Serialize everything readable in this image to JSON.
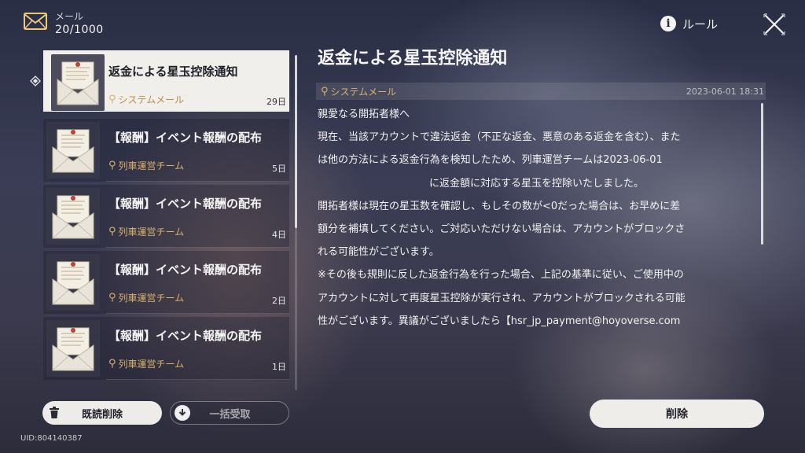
{
  "header": {
    "mail_label": "メール",
    "mail_count": "20/1000",
    "rule_label": "ルール",
    "rule_icon": "info-icon",
    "close_icon": "close-x-icon"
  },
  "mail_list": [
    {
      "subject": "返金による星玉控除通知",
      "sender": "システムメール",
      "age": "29日",
      "selected": true
    },
    {
      "subject": "【報酬】イベント報酬の配布",
      "sender": "列車運営チーム",
      "age": "5日",
      "selected": false
    },
    {
      "subject": "【報酬】イベント報酬の配布",
      "sender": "列車運営チーム",
      "age": "4日",
      "selected": false
    },
    {
      "subject": "【報酬】イベント報酬の配布",
      "sender": "列車運営チーム",
      "age": "2日",
      "selected": false
    },
    {
      "subject": "【報酬】イベント報酬の配布",
      "sender": "列車運営チーム",
      "age": "1日",
      "selected": false
    }
  ],
  "buttons": {
    "delete_read": "既読削除",
    "receive_all": "一括受取",
    "delete": "削除"
  },
  "uid": "UID:804140387",
  "detail": {
    "title": "返金による星玉控除通知",
    "sender": "システムメール",
    "date": "2023-06-01 18:31",
    "lines": [
      "親愛なる開拓者様へ",
      "現在、当該アカウントで違法返金（不正な返金、悪意のある返金を含む）、また",
      "は他の方法による返金行為を検知したため、列車運営チームは2023-06-01",
      "に返金額に対応する星玉を控除いたしました。",
      "開拓者様は現在の星玉数を確認し、もしその数が<0だった場合は、お早めに差",
      "額分を補填してください。ご対応いただけない場合は、アカウントがブロックさ",
      "れる可能性がございます。",
      "※その後も規則に反した返金行為を行った場合、上記の基準に従い、ご使用中の",
      "アカウントに対して再度星玉控除が実行され、アカウントがブロックされる可能",
      "性がございます。異議がございましたら【hsr_jp_payment@hoyoverse.com"
    ]
  },
  "colors": {
    "accent_gold": "#d8b26a",
    "selected_bg": "#f1efeb"
  }
}
